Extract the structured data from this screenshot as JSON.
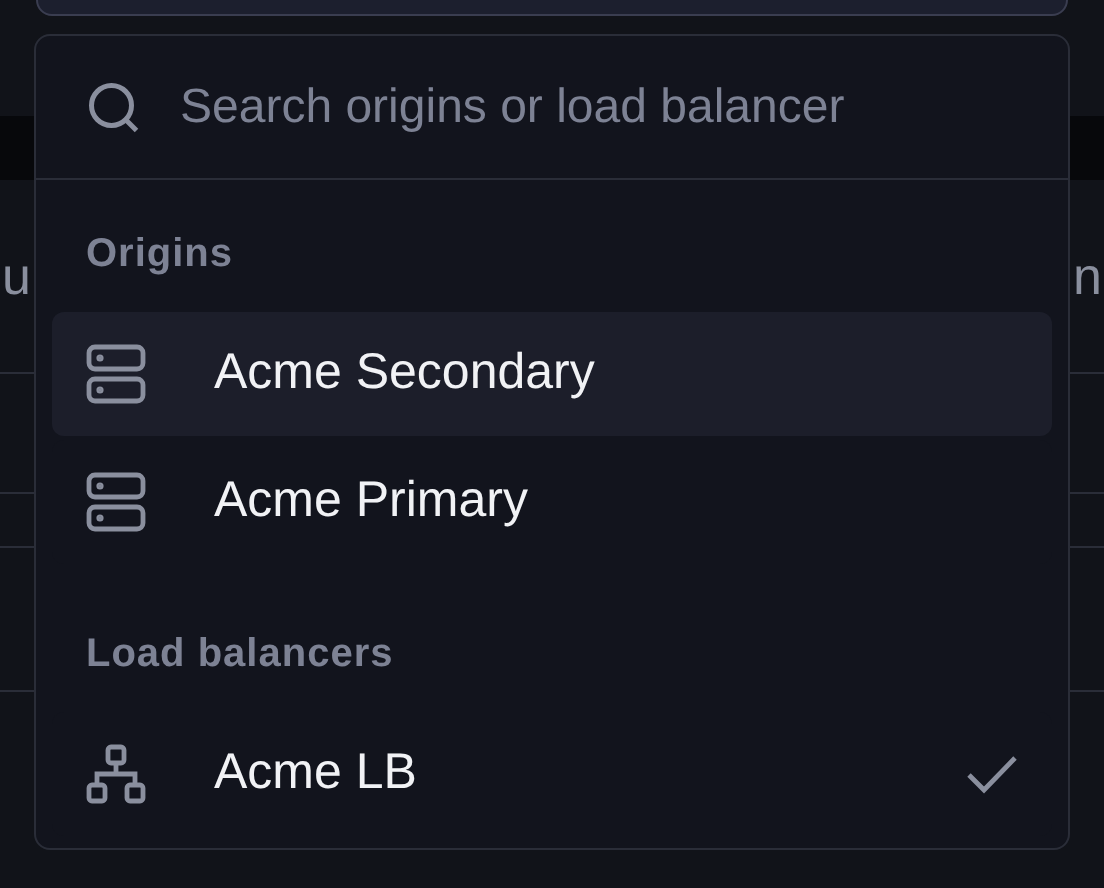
{
  "background": {
    "left_text": "u",
    "right_text": "n"
  },
  "dropdown": {
    "search": {
      "placeholder": "Search origins or load balancer"
    },
    "groups": [
      {
        "label": "Origins",
        "items": [
          {
            "label": "Acme Secondary",
            "kind": "server",
            "highlighted": true,
            "selected": false
          },
          {
            "label": "Acme Primary",
            "kind": "server",
            "highlighted": false,
            "selected": false
          }
        ]
      },
      {
        "label": "Load balancers",
        "items": [
          {
            "label": "Acme LB",
            "kind": "network",
            "highlighted": false,
            "selected": true
          }
        ]
      }
    ]
  }
}
